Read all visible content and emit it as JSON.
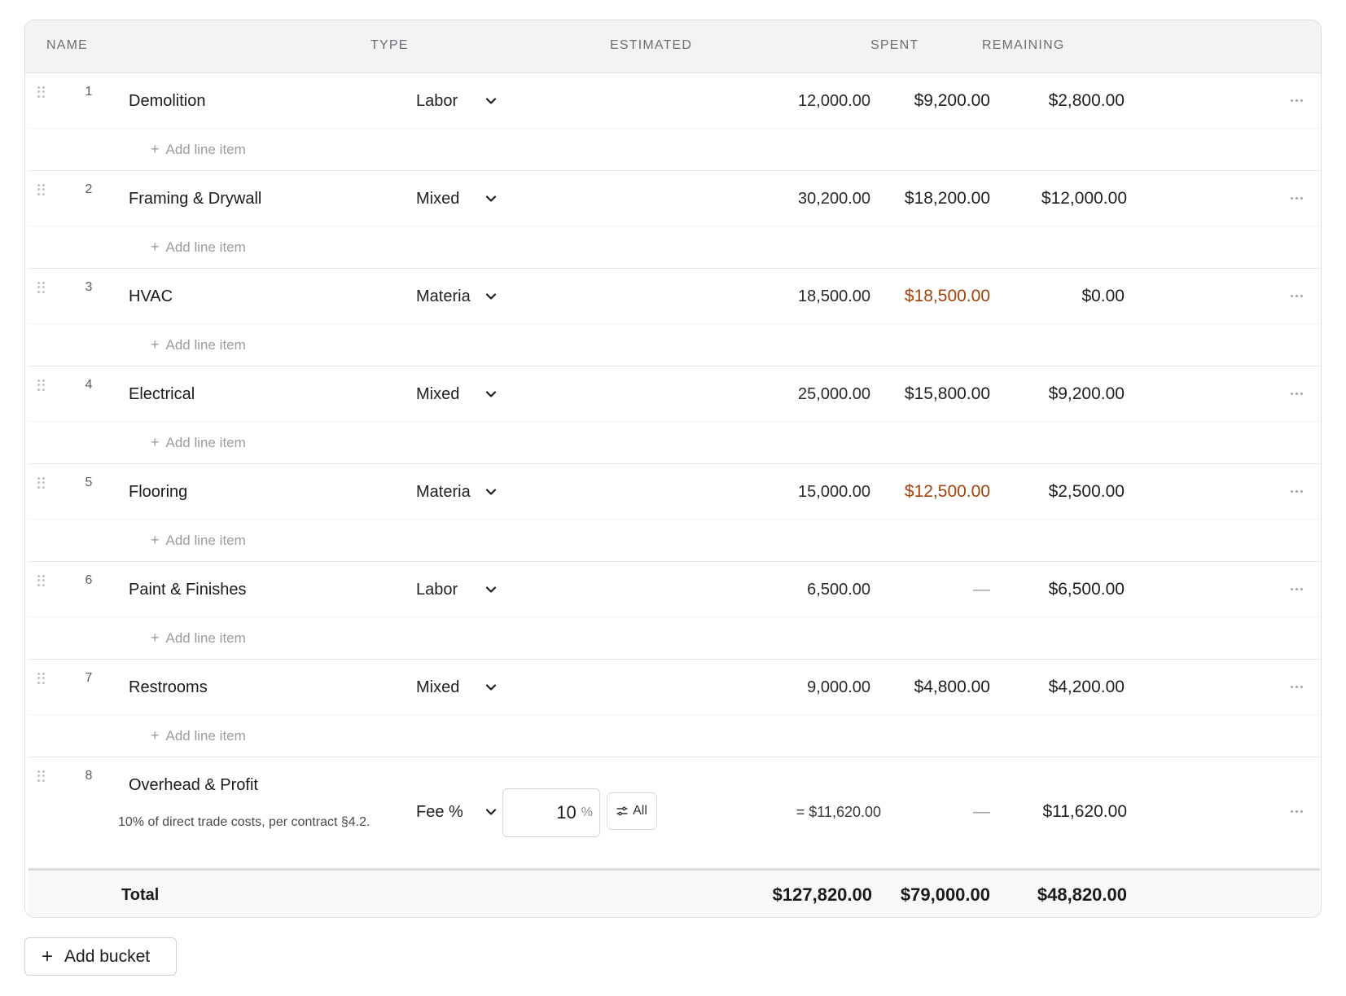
{
  "table": {
    "columns": {
      "name": "NAME",
      "type": "TYPE",
      "estimated": "ESTIMATED",
      "spent": "SPENT",
      "remaining": "REMAINING"
    },
    "add_line_label": "Add line item",
    "rows": [
      {
        "num": "1",
        "name": "Demolition",
        "type": "Labor",
        "estimated": "12,000.00",
        "spent": "$9,200.00",
        "remaining": "$2,800.00",
        "spent_status": "normal"
      },
      {
        "num": "2",
        "name": "Framing & Drywall",
        "type": "Mixed",
        "estimated": "30,200.00",
        "spent": "$18,200.00",
        "remaining": "$12,000.00",
        "spent_status": "normal"
      },
      {
        "num": "3",
        "name": "HVAC",
        "type": "Materia",
        "estimated": "18,500.00",
        "spent": "$18,500.00",
        "remaining": "$0.00",
        "spent_status": "warning"
      },
      {
        "num": "4",
        "name": "Electrical",
        "type": "Mixed",
        "estimated": "25,000.00",
        "spent": "$15,800.00",
        "remaining": "$9,200.00",
        "spent_status": "normal"
      },
      {
        "num": "5",
        "name": "Flooring",
        "type": "Materia",
        "estimated": "15,000.00",
        "spent": "$12,500.00",
        "remaining": "$2,500.00",
        "spent_status": "warning"
      },
      {
        "num": "6",
        "name": "Paint & Finishes",
        "type": "Labor",
        "estimated": "6,500.00",
        "spent": "—",
        "remaining": "$6,500.00",
        "spent_status": "none"
      },
      {
        "num": "7",
        "name": "Restrooms",
        "type": "Mixed",
        "estimated": "9,000.00",
        "spent": "$4,800.00",
        "remaining": "$4,200.00",
        "spent_status": "normal"
      }
    ],
    "overhead": {
      "num": "8",
      "name": "Overhead & Profit",
      "note": "10% of direct trade costs, per contract §4.2.",
      "type": "Fee %",
      "percent_value": "10",
      "percent_sign": "%",
      "apply_all_label": "All",
      "calculated": "= $11,620.00",
      "spent": "—",
      "remaining": "$11,620.00"
    },
    "total": {
      "label": "Total",
      "estimated": "$127,820.00",
      "spent": "$79,000.00",
      "remaining": "$48,820.00"
    }
  },
  "add_bucket_label": "Add bucket",
  "colors": {
    "warning_text": "#a0420a",
    "header_bg": "#f3f3f3"
  },
  "icons": {
    "drag": "drag-handle-icon",
    "chevron": "chevron-down-icon",
    "more": "more-horizontal-icon",
    "plus": "plus-icon",
    "apply": "sliders-icon"
  }
}
